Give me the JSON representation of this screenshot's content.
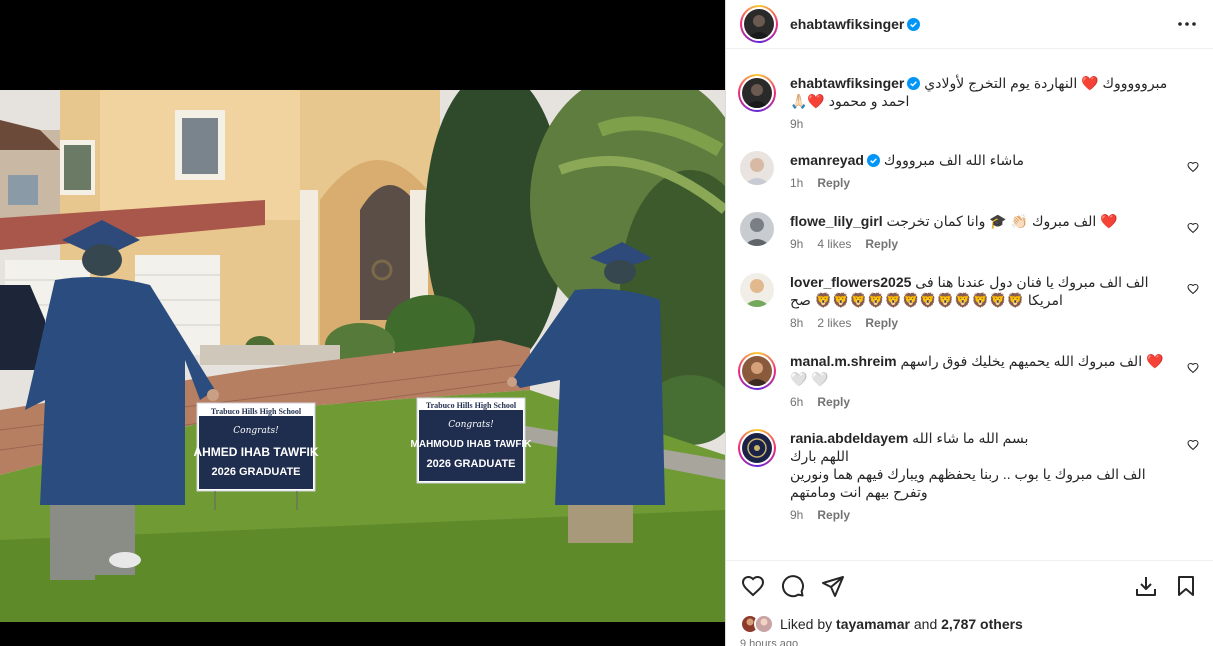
{
  "post": {
    "author": "ehabtawfiksinger",
    "caption": "مبروووووك ❤️ النهاردة يوم التخرج لأولادي احمد و محمود ❤️🙏🏻",
    "caption_time": "9h"
  },
  "photo": {
    "sign_left": {
      "school": "Trabuco Hills High School",
      "congrats": "Congrats!",
      "name": "AHMED IHAB TAWFIK",
      "grad": "2026 GRADUATE"
    },
    "sign_right": {
      "school": "Trabuco Hills High School",
      "congrats": "Congrats!",
      "name": "MAHMOUD IHAB TAWFIK",
      "grad": "2026 GRADUATE"
    }
  },
  "comments": [
    {
      "username": "emanreyad",
      "verified": true,
      "text": "ماشاء الله الف مبروووك",
      "time": "1h",
      "likes": "",
      "reply": "Reply"
    },
    {
      "username": "flowe_lily_girl",
      "verified": false,
      "text": "❤️ الف مبروك 👏🏻 🎓 وانا كمان تخرجت",
      "time": "9h",
      "likes": "4 likes",
      "reply": "Reply"
    },
    {
      "username": "lover_flowers2025",
      "verified": false,
      "text": "الف الف مبروك يا فنان دول عندنا هنا فى امريكا 🦁🦁🦁🦁🦁🦁🦁🦁🦁🦁🦁🦁 صح",
      "time": "8h",
      "likes": "2 likes",
      "reply": "Reply"
    },
    {
      "username": "manal.m.shreim",
      "verified": false,
      "text": "❤️ الف مبروك الله يحميهم يخليك فوق راسهم 🤍 🤍",
      "time": "6h",
      "likes": "",
      "reply": "Reply"
    },
    {
      "username": "rania.abdeldayem",
      "verified": false,
      "text": "بسم الله ما شاء الله\nاللهم بارك\nالف الف مبروك يا بوب .. ربنا يحفظهم ويبارك فيهم هما ونورين وتفرح بيهم انت ومامتهم",
      "time": "9h",
      "likes": "",
      "reply": "Reply"
    }
  ],
  "likes": {
    "prefix": "Liked by",
    "user": "tayamamar",
    "and": "and",
    "others": "2,787 others"
  },
  "time_ago": "9 hours ago",
  "colors": {
    "verified": "#0095f6",
    "heart_red": "#ed4956",
    "muted": "#737373"
  },
  "icons": [
    "more-icon",
    "verified-icon",
    "heart-icon",
    "comment-icon",
    "share-icon",
    "download-icon",
    "bookmark-icon"
  ]
}
